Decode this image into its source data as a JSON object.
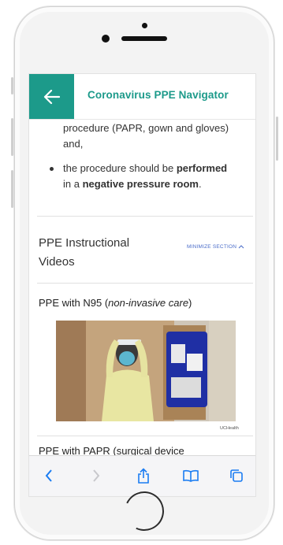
{
  "header": {
    "title": "Coronavirus PPE Navigator"
  },
  "content": {
    "bullet1_line1": "procedure (PAPR, gown and gloves)",
    "bullet1_line2": "and,",
    "bullet2_part1": "the procedure should be ",
    "bullet2_bold1": "performed",
    "bullet2_part2": "in a ",
    "bullet2_bold2": "negative pressure room",
    "bullet2_end": ".",
    "section_title_line1": "PPE Instructional",
    "section_title_line2": "Videos",
    "minimize_label": "MINIMIZE SECTION",
    "video1_title_plain": "PPE with N95 (",
    "video1_title_italic": "non-invasive care",
    "video1_title_close": ")",
    "video1_brand": "UCHealth",
    "video2_title_partial": "PPE with PAPR (surgical device"
  },
  "toolbar": {
    "icons": [
      "back-icon",
      "forward-icon",
      "share-icon",
      "bookmarks-icon",
      "tabs-icon"
    ]
  },
  "colors": {
    "accent": "#1c9a8a",
    "link": "#4a6cc9",
    "ios_blue": "#1a7cf2"
  }
}
